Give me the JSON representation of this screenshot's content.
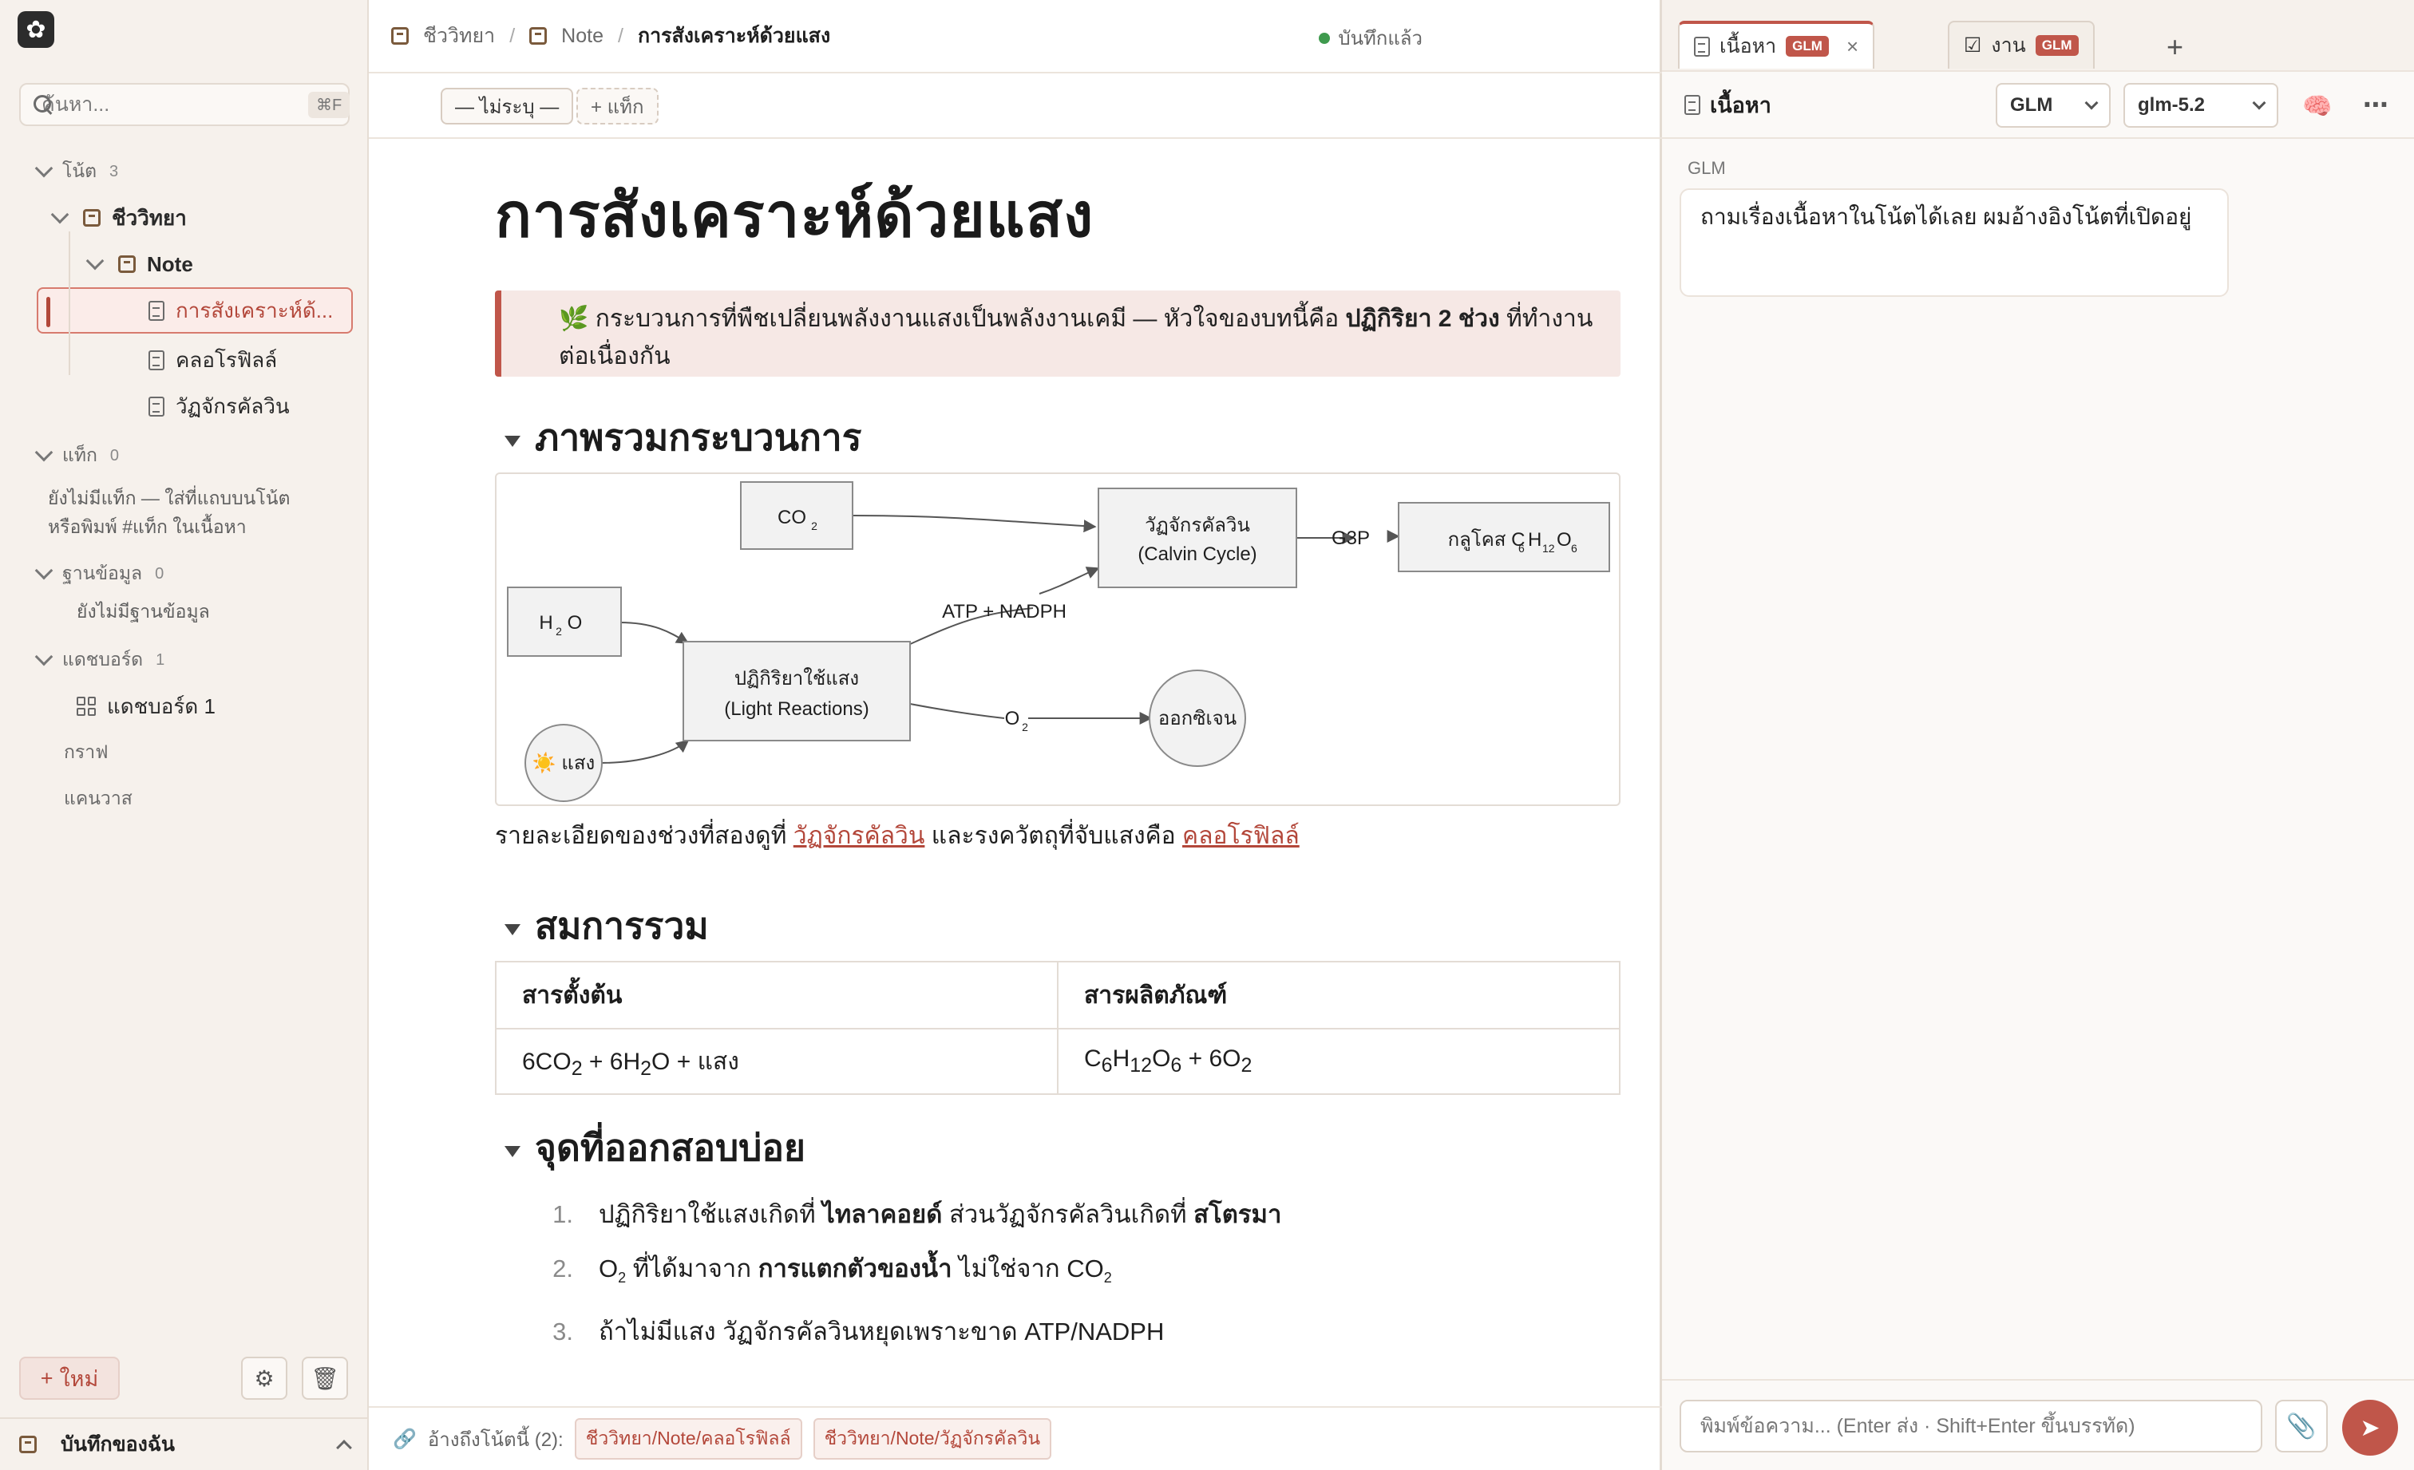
{
  "sidebar": {
    "search_placeholder": "ค้นหา...",
    "search_shortcut": "⌘F",
    "notes_label": "โน้ต",
    "notes_count": "3",
    "folder": "ชีววิทยา",
    "subfolder": "Note",
    "items": [
      "การสังเคราะห์ด้...",
      "คลอโรฟิลล์",
      "วัฏจักรคัลวิน"
    ],
    "tags_label": "แท็ก",
    "tags_count": "0",
    "tags_empty": "ยังไม่มีแท็ก — ใส่ที่แถบบนโน้ต หรือพิมพ์ #แท็ก ในเนื้อหา",
    "db_label": "ฐานข้อมูล",
    "db_count": "0",
    "db_empty": "ยังไม่มีฐานข้อมูล",
    "dash_label": "แดชบอร์ด",
    "dash_count": "1",
    "dash_item": "แดชบอร์ด 1",
    "graph_label": "กราฟ",
    "canvas_label": "แคนวาส",
    "new_label": "ใหม่",
    "vault_name": "บันทึกของฉัน"
  },
  "header": {
    "breadcrumb": [
      "ชีววิทยา",
      "Note",
      "การสังเคราะห์ด้วยแสง"
    ],
    "saved_label": "บันทึกแล้ว",
    "status_pill": "— ไม่ระบุ —",
    "tag_pill": "+ แท็ก"
  },
  "note": {
    "title": "การสังเคราะห์ด้วยแสง",
    "callout_prefix": "🌿 กระบวนการที่พืชเปลี่ยนพลังงานแสงเป็นพลังงานเคมี — หัวใจของบทนี้คือ ",
    "callout_bold": "ปฏิกิริยา 2 ช่วง",
    "callout_suffix": " ที่ทำงานต่อเนื่องกัน",
    "h_overview": "ภาพรวมกระบวนการ",
    "diagram": {
      "co2": "CO",
      "calvin_1": "วัฏจักรคัลวิน",
      "calvin_2": "(Calvin Cycle)",
      "g3p": "G3P",
      "glucose": "กลูโคส C",
      "h2o": "H",
      "atp": "ATP + NADPH",
      "light_1": "ปฏิกิริยาใช้แสง",
      "light_2": "(Light Reactions)",
      "o2": "O",
      "oxygen": "ออกซิเจน",
      "sun": "☀️ แสง"
    },
    "para_prefix": "รายละเอียดของช่วงที่สองดูที่ ",
    "para_link1": "วัฏจักรคัลวิน",
    "para_mid": " และรงควัตถุที่จับแสงคือ ",
    "para_link2": "คลอโรฟิลล์",
    "h_equation": "สมการรวม",
    "table_headers": [
      "สารตั้งต้น",
      "สารผลิตภัณฑ์"
    ],
    "h_exam": "จุดที่ออกสอบบ่อย",
    "list": [
      {
        "num": "1.",
        "a": "ปฏิกิริยาใช้แสงเกิดที่ ",
        "b": "ไทลาคอยด์",
        "c": " ส่วนวัฏจักรคัลวินเกิดที่ ",
        "d": "สโตรมา"
      },
      {
        "num": "2.",
        "a": "O",
        "b": " ที่ได้มาจาก ",
        "c": "การแตกตัวของน้ำ",
        "d": " ไม่ใช่จาก CO"
      },
      {
        "num": "3.",
        "a": "ถ้าไม่มีแสง วัฏจักรคัลวินหยุดเพราะขาด ATP/NADPH"
      }
    ]
  },
  "footer": {
    "backlinks_label": "อ้างถึงโน้ตนี้ (2):",
    "refs": [
      "ชีววิทยา/Note/คลอโรฟิลล์",
      "ชีววิทยา/Note/วัฏจักรคัลวิน"
    ]
  },
  "right_panel": {
    "tabs": [
      {
        "label": "เนื้อหา",
        "badge": "GLM"
      },
      {
        "label": "งาน",
        "badge": "GLM"
      }
    ],
    "head_title": "เนื้อหา",
    "provider": "GLM",
    "model": "glm-5.2",
    "sender": "GLM",
    "message": "ถามเรื่องเนื้อหาในโน้ตได้เลย ผมอ้างอิงโน้ตที่เปิดอยู่",
    "composer_placeholder": "พิมพ์ข้อความ... (Enter ส่ง · Shift+Enter ขึ้นบรรทัด)"
  },
  "colors": {
    "accent": "#c0564a",
    "sidebar_bg": "#f6f1ec",
    "saved_dot": "#3f9a4e"
  }
}
